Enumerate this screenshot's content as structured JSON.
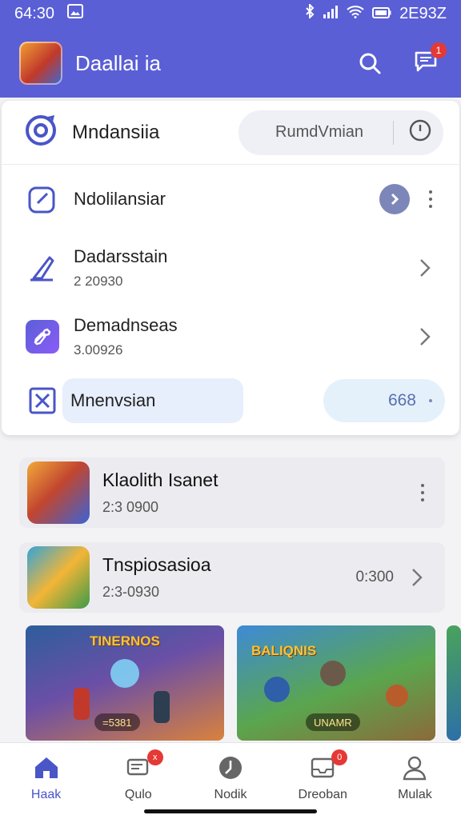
{
  "colors": {
    "accent": "#5a5fd6",
    "badge": "#e53935",
    "active_nav": "#4a55c8"
  },
  "status_bar": {
    "time": "64:30",
    "battery_text": "2E93Z"
  },
  "app_bar": {
    "title": "Daallai ia",
    "search_icon": "search-icon",
    "chat_icon": "chat-icon",
    "chat_badge": "1"
  },
  "main_card": {
    "header": {
      "title": "Mndansiia",
      "filter_label": "RumdVmian"
    },
    "rows": [
      {
        "title": "Ndolilansiar"
      },
      {
        "title": "Dadarsstain",
        "subtitle": "2 20930"
      },
      {
        "title": "Demadnseas",
        "subtitle": "3.00926"
      }
    ],
    "last_row": {
      "label": "Mnenvsian",
      "count": "668"
    }
  },
  "games": [
    {
      "title": "Klaolith Isanet",
      "subtitle": "2:3 0900"
    },
    {
      "title": "Tnspiosasioa",
      "subtitle": "2:3-0930",
      "meta": "0:300"
    }
  ],
  "banners": [
    {
      "title": "TINERNOS",
      "chip": "=5381"
    },
    {
      "title": "BALIQNIS",
      "chip": "UNAMR"
    }
  ],
  "bottom_nav": [
    {
      "label": "Haak"
    },
    {
      "label": "Qulo",
      "badge": "x"
    },
    {
      "label": "Nodik"
    },
    {
      "label": "Dreoban",
      "badge": "0"
    },
    {
      "label": "Mulak"
    }
  ]
}
